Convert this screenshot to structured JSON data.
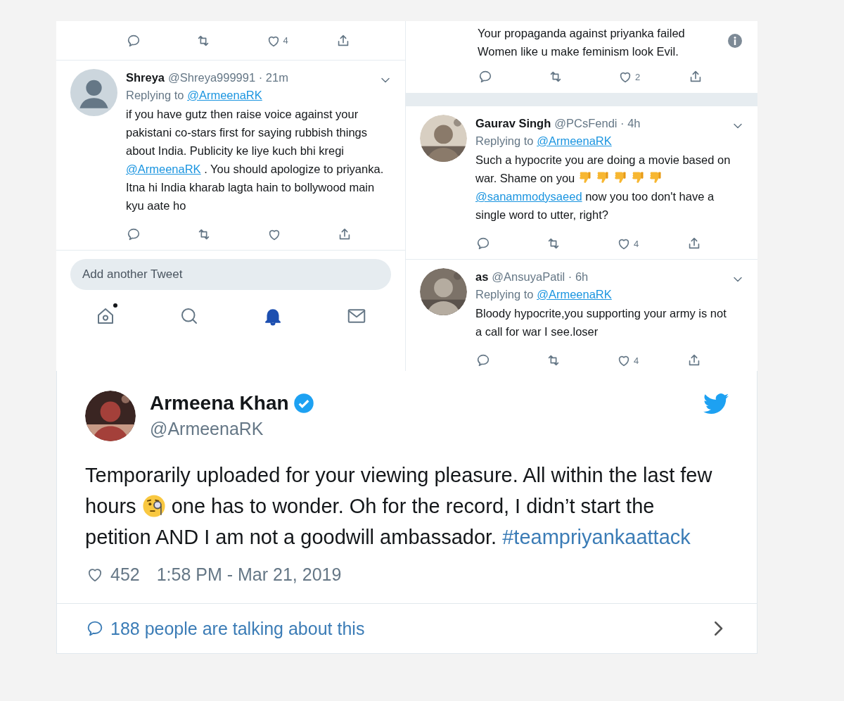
{
  "left_panel": {
    "top_actions": {
      "likes": "4"
    },
    "replies": [
      {
        "name": "Shreya",
        "meta": "@Shreya999991 · 21m",
        "avatar": {
          "kind": "default"
        },
        "replying_label": "Replying to",
        "replying_to": "@ArmeenaRK",
        "body": [
          {
            "kind": "text",
            "text": "if you have gutz then raise voice against your pakistani co-stars first for saying rubbish things about India. Publicity ke liye kuch bhi kregi "
          },
          {
            "kind": "mention",
            "text": "@ArmeenaRK"
          },
          {
            "kind": "text",
            "text": " . You should apologize to priyanka. Itna hi India kharab lagta hain to bollywood main kyu aate ho"
          }
        ]
      }
    ],
    "compose": {
      "placeholder": "Add another Tweet"
    },
    "nav": [
      {
        "kind": "home",
        "selected": false,
        "badge": true
      },
      {
        "kind": "search",
        "selected": false,
        "badge": false
      },
      {
        "kind": "notifications",
        "selected": true,
        "badge": false
      },
      {
        "kind": "messages",
        "selected": false,
        "badge": false
      }
    ]
  },
  "right_panel": {
    "top_tweet": {
      "body": [
        {
          "kind": "text",
          "text": "Your propaganda against priyanka failed Women like u make feminism look Evil."
        }
      ]
    },
    "top_actions": {
      "likes": "2"
    },
    "replies": [
      {
        "name": "Gaurav Singh",
        "meta": "@PCsFendi · 4h",
        "avatar": {
          "kind": "picture"
        },
        "replying_label": "Replying to",
        "replying_to": "@ArmeenaRK",
        "body": [
          {
            "kind": "text",
            "text": "Such a hypocrite you are doing a movie based on war. Shame on you "
          },
          {
            "kind": "thumbs_down"
          },
          {
            "kind": "thumbs_down"
          },
          {
            "kind": "thumbs_down"
          },
          {
            "kind": "thumbs_down"
          },
          {
            "kind": "thumbs_down"
          },
          {
            "kind": "mention",
            "text": "@sanammodysaeed"
          },
          {
            "kind": "text",
            "text": " now you too don't have a single word to utter, right?"
          }
        ],
        "actions": {
          "likes": "4"
        }
      },
      {
        "name": "as",
        "meta": "@AnsuyaPatil · 6h",
        "avatar": {
          "kind": "picture"
        },
        "replying_label": "Replying to",
        "replying_to": "@ArmeenaRK",
        "body": [
          {
            "kind": "text",
            "text": "Bloody hypocrite,you supporting your army is not a call for war I see.loser"
          }
        ],
        "actions": {
          "likes": "4"
        }
      }
    ]
  },
  "tweet": {
    "author": {
      "name": "Armeena Khan",
      "verified": true,
      "handle": "@ArmeenaRK",
      "avatar": {
        "kind": "picture"
      }
    },
    "body": [
      {
        "kind": "text",
        "text": "Temporarily uploaded for your viewing pleasure. All within the last few hours "
      },
      {
        "kind": "monocle"
      },
      {
        "kind": "text",
        "text": " one has to wonder. Oh for the record, I didn’t start the petition AND I am not a goodwill ambassador. "
      },
      {
        "kind": "hashtag",
        "text": "#teampriyankaattack"
      }
    ],
    "likes": "452",
    "timestamp": "1:58 PM - Mar 21, 2019",
    "footer": "188 people are talking about this"
  }
}
